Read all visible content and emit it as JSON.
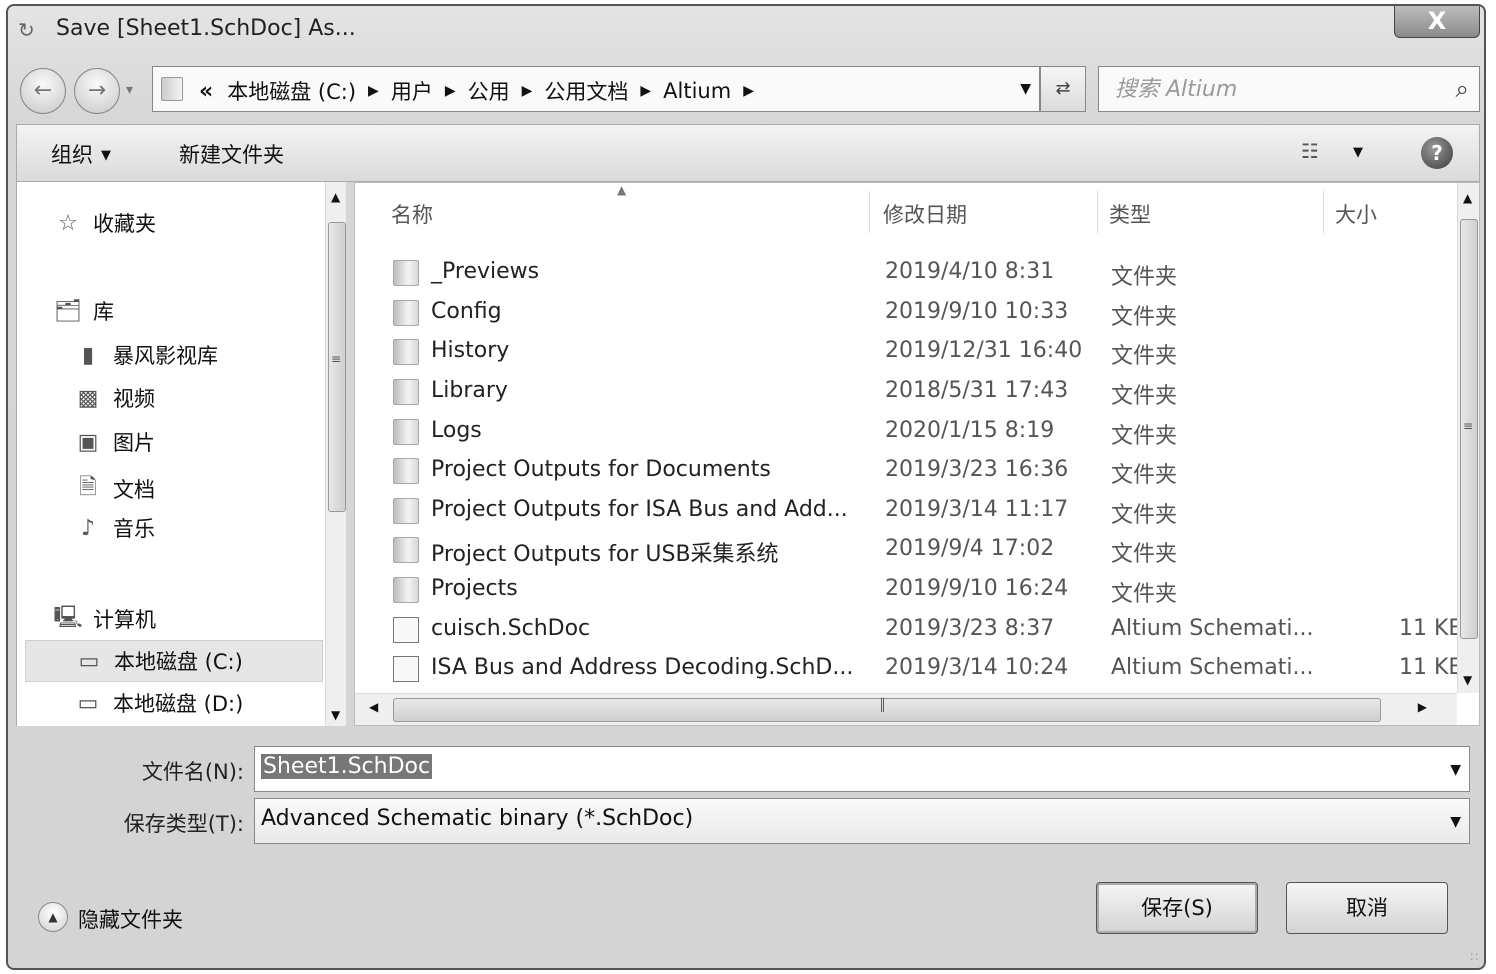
{
  "window": {
    "title": "Save [Sheet1.SchDoc] As...",
    "close_label": "X"
  },
  "address": {
    "lead": "«",
    "crumbs": [
      "本地磁盘 (C:)",
      "用户",
      "公用",
      "公用文档",
      "Altium"
    ]
  },
  "search": {
    "placeholder": "搜索 Altium"
  },
  "toolbar": {
    "organize_label": "组织",
    "new_folder_label": "新建文件夹",
    "help_label": "?"
  },
  "nav_pane": {
    "favorites": "收藏夹",
    "libraries": "库",
    "library_items": [
      "暴风影视库",
      "视频",
      "图片",
      "文档",
      "音乐"
    ],
    "computer": "计算机",
    "drives": [
      "本地磁盘 (C:)",
      "本地磁盘 (D:)"
    ]
  },
  "file_list": {
    "columns": {
      "name": "名称",
      "date": "修改日期",
      "type": "类型",
      "size": "大小"
    },
    "rows": [
      {
        "name": "_Previews",
        "date": "2019/4/10 8:31",
        "type": "文件夹",
        "size": ""
      },
      {
        "name": "Config",
        "date": "2019/9/10 10:33",
        "type": "文件夹",
        "size": ""
      },
      {
        "name": "History",
        "date": "2019/12/31 16:40",
        "type": "文件夹",
        "size": ""
      },
      {
        "name": "Library",
        "date": "2018/5/31 17:43",
        "type": "文件夹",
        "size": ""
      },
      {
        "name": "Logs",
        "date": "2020/1/15 8:19",
        "type": "文件夹",
        "size": ""
      },
      {
        "name": "Project Outputs for Documents",
        "date": "2019/3/23 16:36",
        "type": "文件夹",
        "size": ""
      },
      {
        "name": "Project Outputs for ISA Bus and Add...",
        "date": "2019/3/14 11:17",
        "type": "文件夹",
        "size": ""
      },
      {
        "name": "Project Outputs for USB采集系统",
        "date": "2019/9/4 17:02",
        "type": "文件夹",
        "size": ""
      },
      {
        "name": "Projects",
        "date": "2019/9/10 16:24",
        "type": "文件夹",
        "size": ""
      },
      {
        "name": "cuisch.SchDoc",
        "date": "2019/3/23 8:37",
        "type": "Altium Schemati...",
        "size": "11 KE"
      },
      {
        "name": "ISA Bus and Address Decoding.SchD...",
        "date": "2019/3/14 10:24",
        "type": "Altium Schemati...",
        "size": "11 KE"
      }
    ]
  },
  "form": {
    "filename_label": "文件名(N):",
    "filename_value": "Sheet1.SchDoc",
    "filetype_label": "保存类型(T):",
    "filetype_value": "Advanced Schematic binary (*.SchDoc)"
  },
  "footer": {
    "hide_folders_label": "隐藏文件夹",
    "save_label": "保存(S)",
    "cancel_label": "取消"
  }
}
